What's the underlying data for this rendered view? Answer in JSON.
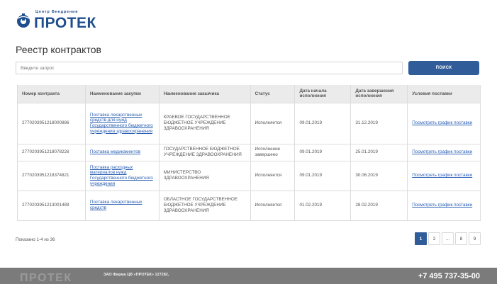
{
  "brand": {
    "subtitle": "Центр Внедрения",
    "name": "ПРОТЕК",
    "color": "#1f4e8c"
  },
  "page": {
    "title": "Реестр контрактов"
  },
  "search": {
    "placeholder": "Введите запрос",
    "button_label": "ПОИСК"
  },
  "table": {
    "headers": {
      "number": "Номер контракта",
      "purchase": "Наименование закупки",
      "customer": "Наименование заказчика",
      "status": "Статус",
      "start": "Дата начала исполнения",
      "end": "Дата завершения исполнения",
      "conditions": "Условия поставки"
    },
    "rows": [
      {
        "number": "2770203951218000886",
        "purchase": "Поставка лекарственных средств для нужд Государственного бюджетного учреждения здравоохранения",
        "customer": "КРАЕВОЕ ГОСУДАРСТВЕННОЕ БЮДЖЕТНОЕ УЧРЕЖДЕНИЕ ЗДРАВООХРАНЕНИЯ",
        "status": "Исполняется",
        "start": "09.01.2019",
        "end": "31.12.2019",
        "conditions": "Посмотреть график поставки"
      },
      {
        "number": "2770203951218078226",
        "purchase": "Поставка медикаментов",
        "customer": "ГОСУДАРСТВЕННОЕ БЮДЖЕТНОЕ УЧРЕЖДЕНИЕ ЗДРАВООХРАНЕНИЯ",
        "status": "Исполнение завершено",
        "start": "09.01.2019",
        "end": "25.01.2019",
        "conditions": "Посмотреть график поставки"
      },
      {
        "number": "2770203951218374821",
        "purchase": "Поставка расходных материалов нужд Государственного бюджетного учреждения",
        "customer": "МИНИСТЕРСТВО ЗДРАВООХРАНЕНИЯ",
        "status": "Исполняется",
        "start": "09.01.2019",
        "end": "30.06.2019",
        "conditions": "Посмотреть график поставки"
      },
      {
        "number": "2770203951213001489",
        "purchase": "Поставка лекарственных средств",
        "customer": "ОБЛАСТНОЕ ГОСУДАРСТВЕННОЕ БЮДЖЕТНОЕ УЧРЕЖДЕНИЕ ЗДРАВООХРАНЕНИЯ",
        "status": "Исполняется",
        "start": "01.02.2019",
        "end": "28.02.2019",
        "conditions": "Посмотреть график поставки"
      }
    ]
  },
  "summary": {
    "shown": "Показано 1-4 из 36"
  },
  "pagination": {
    "pages": [
      "1",
      "2",
      "...",
      "8",
      "9"
    ],
    "active": "1",
    "accent": "#315c9a"
  },
  "footer": {
    "logo": "ПРОТЕК",
    "company": "ЗАО Фирма ЦВ «ПРОТЕК» 127282,",
    "phone": "+7 495 737-35-00",
    "background": "#7b7b7b"
  }
}
